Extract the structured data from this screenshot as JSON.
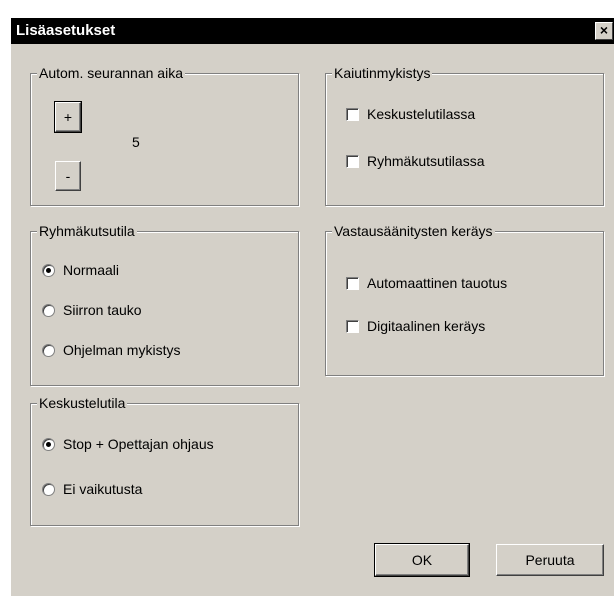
{
  "window": {
    "title": "Lisäasetukset",
    "close_glyph": "×"
  },
  "auto_follow": {
    "legend": "Autom. seurannan aika",
    "plus_label": "+",
    "minus_label": "-",
    "value": "5"
  },
  "speaker_mute": {
    "legend": "Kaiutinmykistys",
    "options": [
      {
        "label": "Keskustelutilassa",
        "checked": false
      },
      {
        "label": "Ryhmäkutsutilassa",
        "checked": false
      }
    ]
  },
  "group_call": {
    "legend": "Ryhmäkutsutila",
    "options": [
      {
        "label": "Normaali",
        "selected": true
      },
      {
        "label": "Siirron tauko",
        "selected": false
      },
      {
        "label": "Ohjelman mykistys",
        "selected": false
      }
    ]
  },
  "response_collection": {
    "legend": "Vastausäänitysten keräys",
    "options": [
      {
        "label": "Automaattinen tauotus",
        "checked": false
      },
      {
        "label": "Digitaalinen keräys",
        "checked": false
      }
    ]
  },
  "conversation": {
    "legend": "Keskustelutila",
    "options": [
      {
        "label": "Stop + Opettajan ohjaus",
        "selected": true
      },
      {
        "label": "Ei vaikutusta",
        "selected": false
      }
    ]
  },
  "buttons": {
    "ok": "OK",
    "cancel": "Peruuta"
  }
}
